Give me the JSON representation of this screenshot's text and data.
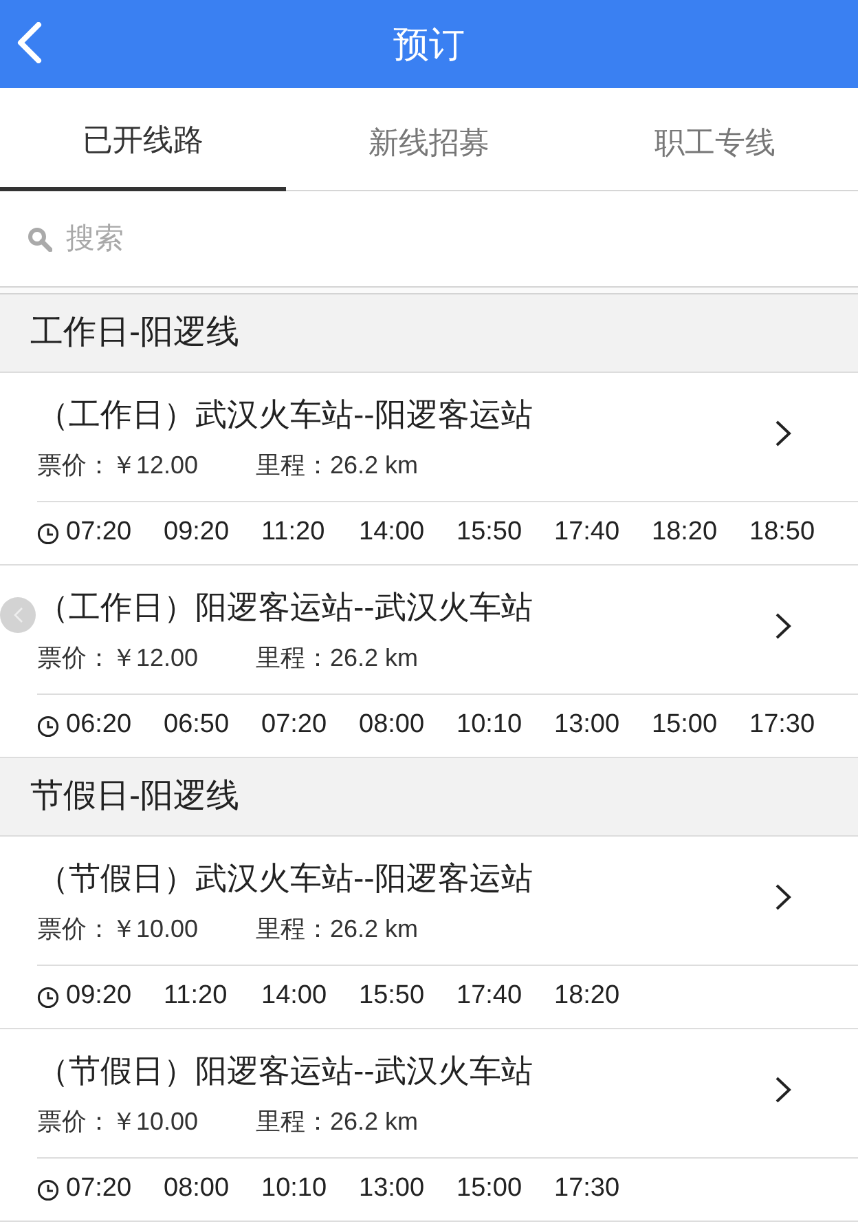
{
  "header": {
    "title": "预订"
  },
  "tabs": [
    {
      "label": "已开线路",
      "selected": true
    },
    {
      "label": "新线招募",
      "selected": false
    },
    {
      "label": "职工专线",
      "selected": false
    }
  ],
  "search": {
    "placeholder": "搜索"
  },
  "groups": [
    {
      "title": "工作日-阳逻线",
      "routes": [
        {
          "title": "（工作日）武汉火车站--阳逻客运站",
          "price": "票价：￥12.00",
          "distance": "里程：26.2 km",
          "times": [
            "07:20",
            "09:20",
            "11:20",
            "14:00",
            "15:50",
            "17:40",
            "18:20",
            "18:50"
          ]
        },
        {
          "title": "（工作日）阳逻客运站--武汉火车站",
          "price": "票价：￥12.00",
          "distance": "里程：26.2 km",
          "times": [
            "06:20",
            "06:50",
            "07:20",
            "08:00",
            "10:10",
            "13:00",
            "15:00",
            "17:30"
          ]
        }
      ]
    },
    {
      "title": "节假日-阳逻线",
      "routes": [
        {
          "title": "（节假日）武汉火车站--阳逻客运站",
          "price": "票价：￥10.00",
          "distance": "里程：26.2 km",
          "times": [
            "09:20",
            "11:20",
            "14:00",
            "15:50",
            "17:40",
            "18:20"
          ]
        },
        {
          "title": "（节假日）阳逻客运站--武汉火车站",
          "price": "票价：￥10.00",
          "distance": "里程：26.2 km",
          "times": [
            "07:20",
            "08:00",
            "10:10",
            "13:00",
            "15:00",
            "17:30"
          ]
        }
      ]
    }
  ]
}
